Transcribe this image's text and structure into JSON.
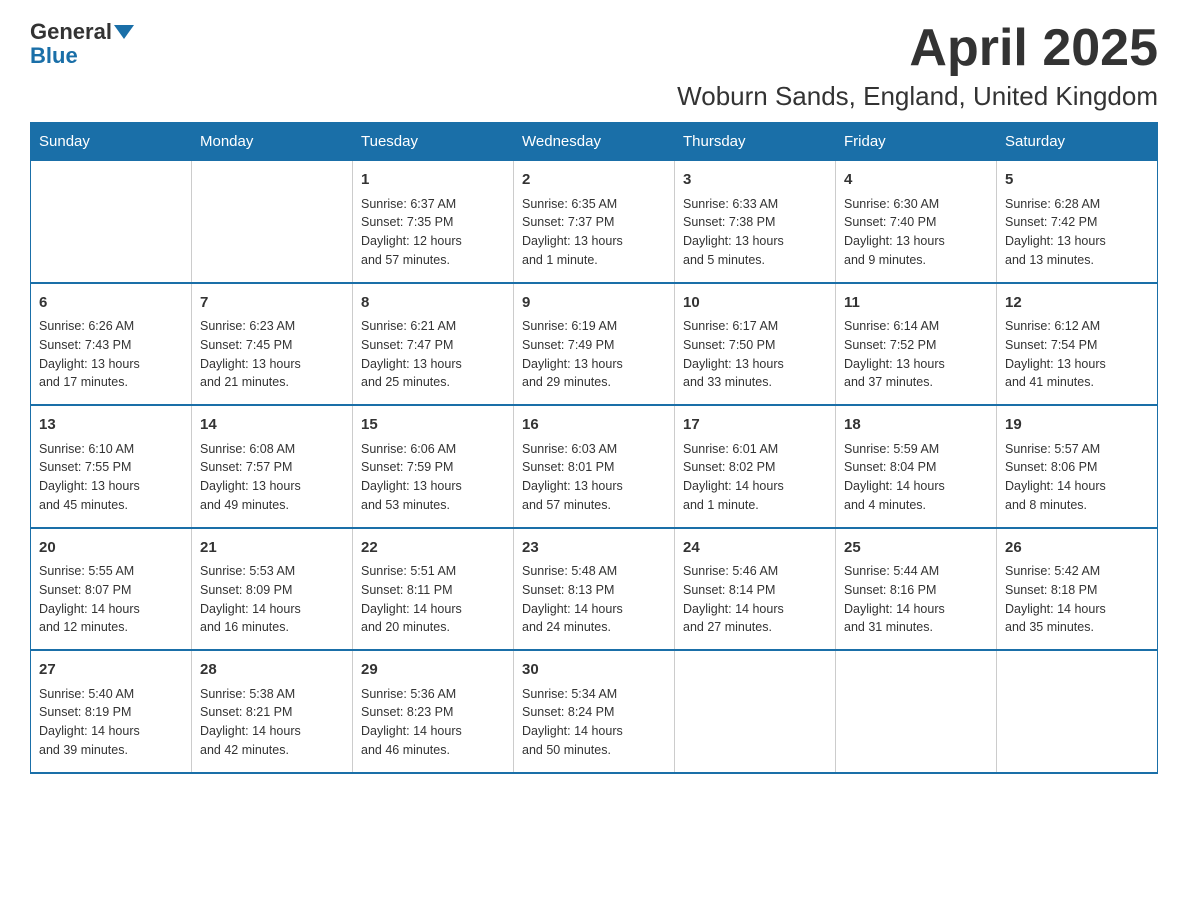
{
  "header": {
    "logo_general": "General",
    "logo_blue": "Blue",
    "month_title": "April 2025",
    "location": "Woburn Sands, England, United Kingdom"
  },
  "days_of_week": [
    "Sunday",
    "Monday",
    "Tuesday",
    "Wednesday",
    "Thursday",
    "Friday",
    "Saturday"
  ],
  "weeks": [
    [
      {
        "day": "",
        "info": ""
      },
      {
        "day": "",
        "info": ""
      },
      {
        "day": "1",
        "info": "Sunrise: 6:37 AM\nSunset: 7:35 PM\nDaylight: 12 hours\nand 57 minutes."
      },
      {
        "day": "2",
        "info": "Sunrise: 6:35 AM\nSunset: 7:37 PM\nDaylight: 13 hours\nand 1 minute."
      },
      {
        "day": "3",
        "info": "Sunrise: 6:33 AM\nSunset: 7:38 PM\nDaylight: 13 hours\nand 5 minutes."
      },
      {
        "day": "4",
        "info": "Sunrise: 6:30 AM\nSunset: 7:40 PM\nDaylight: 13 hours\nand 9 minutes."
      },
      {
        "day": "5",
        "info": "Sunrise: 6:28 AM\nSunset: 7:42 PM\nDaylight: 13 hours\nand 13 minutes."
      }
    ],
    [
      {
        "day": "6",
        "info": "Sunrise: 6:26 AM\nSunset: 7:43 PM\nDaylight: 13 hours\nand 17 minutes."
      },
      {
        "day": "7",
        "info": "Sunrise: 6:23 AM\nSunset: 7:45 PM\nDaylight: 13 hours\nand 21 minutes."
      },
      {
        "day": "8",
        "info": "Sunrise: 6:21 AM\nSunset: 7:47 PM\nDaylight: 13 hours\nand 25 minutes."
      },
      {
        "day": "9",
        "info": "Sunrise: 6:19 AM\nSunset: 7:49 PM\nDaylight: 13 hours\nand 29 minutes."
      },
      {
        "day": "10",
        "info": "Sunrise: 6:17 AM\nSunset: 7:50 PM\nDaylight: 13 hours\nand 33 minutes."
      },
      {
        "day": "11",
        "info": "Sunrise: 6:14 AM\nSunset: 7:52 PM\nDaylight: 13 hours\nand 37 minutes."
      },
      {
        "day": "12",
        "info": "Sunrise: 6:12 AM\nSunset: 7:54 PM\nDaylight: 13 hours\nand 41 minutes."
      }
    ],
    [
      {
        "day": "13",
        "info": "Sunrise: 6:10 AM\nSunset: 7:55 PM\nDaylight: 13 hours\nand 45 minutes."
      },
      {
        "day": "14",
        "info": "Sunrise: 6:08 AM\nSunset: 7:57 PM\nDaylight: 13 hours\nand 49 minutes."
      },
      {
        "day": "15",
        "info": "Sunrise: 6:06 AM\nSunset: 7:59 PM\nDaylight: 13 hours\nand 53 minutes."
      },
      {
        "day": "16",
        "info": "Sunrise: 6:03 AM\nSunset: 8:01 PM\nDaylight: 13 hours\nand 57 minutes."
      },
      {
        "day": "17",
        "info": "Sunrise: 6:01 AM\nSunset: 8:02 PM\nDaylight: 14 hours\nand 1 minute."
      },
      {
        "day": "18",
        "info": "Sunrise: 5:59 AM\nSunset: 8:04 PM\nDaylight: 14 hours\nand 4 minutes."
      },
      {
        "day": "19",
        "info": "Sunrise: 5:57 AM\nSunset: 8:06 PM\nDaylight: 14 hours\nand 8 minutes."
      }
    ],
    [
      {
        "day": "20",
        "info": "Sunrise: 5:55 AM\nSunset: 8:07 PM\nDaylight: 14 hours\nand 12 minutes."
      },
      {
        "day": "21",
        "info": "Sunrise: 5:53 AM\nSunset: 8:09 PM\nDaylight: 14 hours\nand 16 minutes."
      },
      {
        "day": "22",
        "info": "Sunrise: 5:51 AM\nSunset: 8:11 PM\nDaylight: 14 hours\nand 20 minutes."
      },
      {
        "day": "23",
        "info": "Sunrise: 5:48 AM\nSunset: 8:13 PM\nDaylight: 14 hours\nand 24 minutes."
      },
      {
        "day": "24",
        "info": "Sunrise: 5:46 AM\nSunset: 8:14 PM\nDaylight: 14 hours\nand 27 minutes."
      },
      {
        "day": "25",
        "info": "Sunrise: 5:44 AM\nSunset: 8:16 PM\nDaylight: 14 hours\nand 31 minutes."
      },
      {
        "day": "26",
        "info": "Sunrise: 5:42 AM\nSunset: 8:18 PM\nDaylight: 14 hours\nand 35 minutes."
      }
    ],
    [
      {
        "day": "27",
        "info": "Sunrise: 5:40 AM\nSunset: 8:19 PM\nDaylight: 14 hours\nand 39 minutes."
      },
      {
        "day": "28",
        "info": "Sunrise: 5:38 AM\nSunset: 8:21 PM\nDaylight: 14 hours\nand 42 minutes."
      },
      {
        "day": "29",
        "info": "Sunrise: 5:36 AM\nSunset: 8:23 PM\nDaylight: 14 hours\nand 46 minutes."
      },
      {
        "day": "30",
        "info": "Sunrise: 5:34 AM\nSunset: 8:24 PM\nDaylight: 14 hours\nand 50 minutes."
      },
      {
        "day": "",
        "info": ""
      },
      {
        "day": "",
        "info": ""
      },
      {
        "day": "",
        "info": ""
      }
    ]
  ]
}
